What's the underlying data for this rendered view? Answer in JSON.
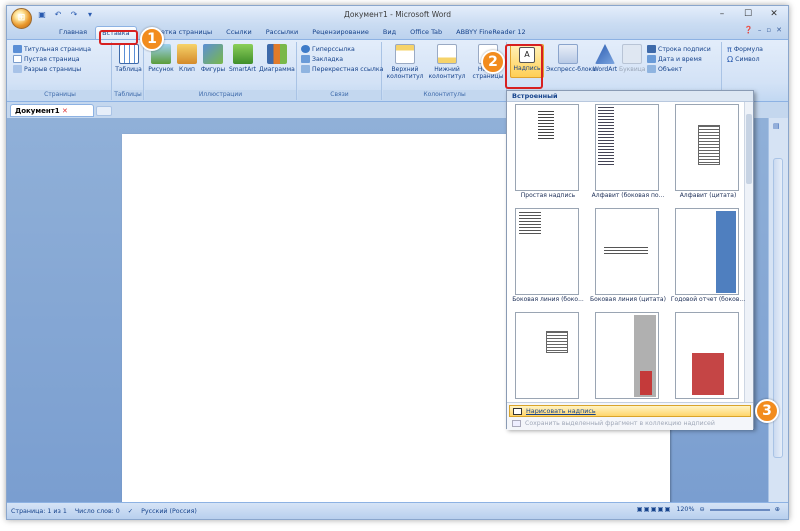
{
  "window": {
    "title": "Документ1 - Microsoft Word"
  },
  "qat": {
    "save_icon": "save-icon",
    "undo": "↶",
    "redo": "↷"
  },
  "tabs": [
    "Главная",
    "Вставка",
    "Разметка страницы",
    "Ссылки",
    "Рассылки",
    "Рецензирование",
    "Вид",
    "Office Tab",
    "ABBYY FineReader 12"
  ],
  "ribbon": {
    "pages": {
      "items": [
        "Титульная страница",
        "Пустая страница",
        "Разрыв страницы"
      ],
      "label": "Страницы"
    },
    "tables": {
      "button": "Таблица",
      "label": "Таблицы"
    },
    "illustrations": {
      "buttons": [
        "Рисунок",
        "Клип",
        "Фигуры",
        "SmartArt",
        "Диаграмма"
      ],
      "label": "Иллюстрации"
    },
    "links": {
      "items": [
        "Гиперссылка",
        "Закладка",
        "Перекрестная ссылка"
      ],
      "label": "Связи"
    },
    "headers": {
      "header": "Верхний колонтитул",
      "footer": "Нижний колонтитул",
      "pagenum": "Номер страницы",
      "label": "Колонтитулы"
    },
    "text": {
      "textbox": "Надпись",
      "quickparts": "Экспресс-блоки",
      "wordart": "WordArt",
      "dropcap": "Буквица",
      "signature": "Строка подписи",
      "datetime": "Дата и время",
      "object": "Объект"
    },
    "symbols": {
      "formula": "Формула",
      "symbol": "Символ"
    }
  },
  "doc_tab": {
    "label": "Документ1"
  },
  "dropdown": {
    "header": "Встроенный",
    "items": [
      {
        "caption": "Простая надпись"
      },
      {
        "caption": "Алфавит (боковая по..."
      },
      {
        "caption": "Алфавит (цитата)"
      },
      {
        "caption": "Боковая линия (боко..."
      },
      {
        "caption": "Боковая линия (цитата)"
      },
      {
        "caption": "Годовой отчет (боков..."
      },
      {
        "caption": ""
      },
      {
        "caption": ""
      },
      {
        "caption": ""
      }
    ],
    "draw": "Нарисовать надпись",
    "save": "Сохранить выделенный фрагмент в коллекцию надписей"
  },
  "status": {
    "page": "Страница: 1 из 1",
    "words": "Число слов: 0",
    "lang": "Русский (Россия)",
    "zoom": "120%"
  },
  "markers": [
    "1",
    "2",
    "3"
  ]
}
